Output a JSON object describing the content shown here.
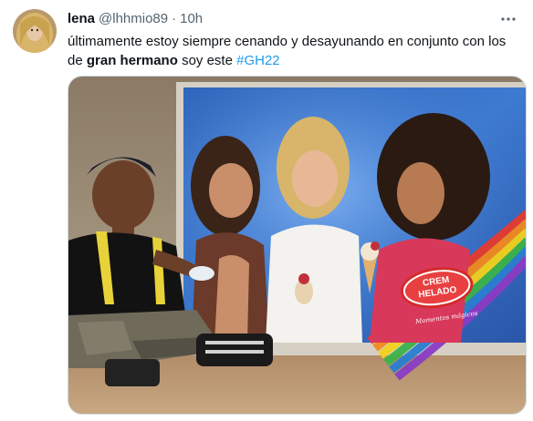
{
  "tweet": {
    "display_name": "lena",
    "handle": "@lhhmio89",
    "separator": "·",
    "time": "10h",
    "text_part1": "últimamente estoy siempre cenando y desayunando en conjunto con los de",
    "text_bold": "gran hermano",
    "text_part2": "soy este",
    "hashtag": "#GH22"
  },
  "media": {
    "brand_line1": "CREM",
    "brand_line2": "HELADO",
    "brand_tagline": "Momentos mágicos"
  },
  "icons": {
    "more": "more-horizontal-icon"
  },
  "colors": {
    "text": "#0f1419",
    "secondary": "#536471",
    "link": "#1d9bf0"
  }
}
